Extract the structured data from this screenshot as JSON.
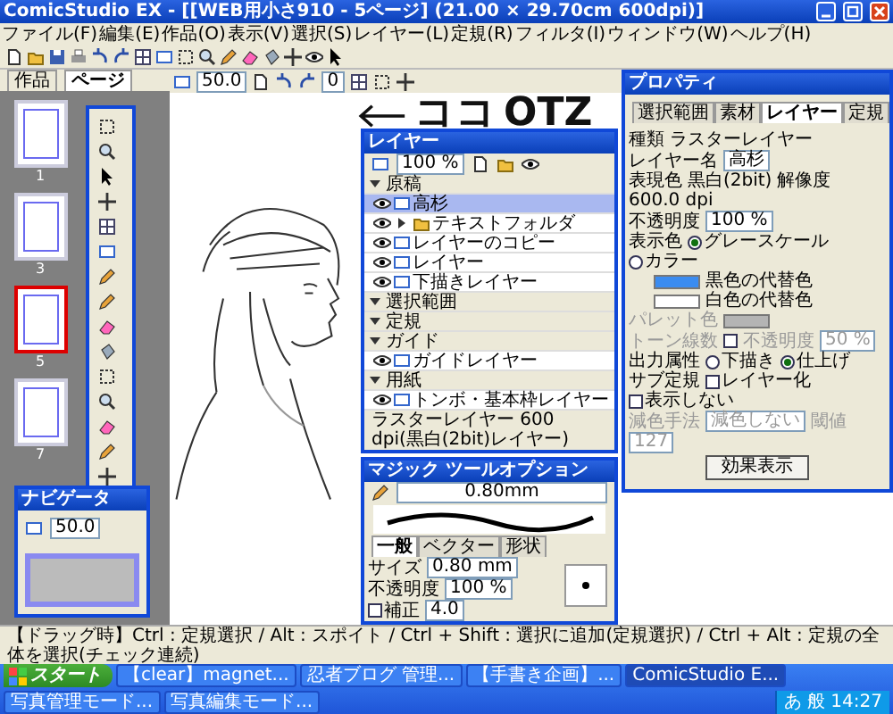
{
  "window": {
    "title": "ComicStudio EX - [[WEB用小さ910 - 5ページ] (21.00 × 29.70cm 600dpi)]"
  },
  "menu": [
    "ファイル(F)",
    "編集(E)",
    "作品(O)",
    "表示(V)",
    "選択(S)",
    "レイヤー(L)",
    "定規(R)",
    "フィルタ(I)",
    "ウィンドウ(W)",
    "ヘルプ(H)"
  ],
  "side_tabs": [
    {
      "label": "作品",
      "selected": false
    },
    {
      "label": "ページ",
      "selected": true
    }
  ],
  "pages": [
    {
      "number": "1",
      "selected": false
    },
    {
      "number": "3",
      "selected": false
    },
    {
      "number": "5",
      "selected": true
    },
    {
      "number": "7",
      "selected": false
    }
  ],
  "canvas_toolbar": {
    "zoom": "50.0",
    "rotation": "0"
  },
  "canvas": {
    "notes": [
      "ココ",
      "OTZ"
    ]
  },
  "navigator": {
    "title": "ナビゲータ",
    "zoom": "50.0"
  },
  "properties": {
    "title": "プロパティ",
    "tabs": [
      {
        "label": "選択範囲",
        "selected": false
      },
      {
        "label": "素材",
        "selected": false
      },
      {
        "label": "レイヤー",
        "selected": true
      },
      {
        "label": "定規",
        "selected": false
      }
    ],
    "rows": [
      {
        "kind": "text",
        "label": "種類",
        "value": "ラスターレイヤー"
      },
      {
        "kind": "field",
        "label": "レイヤー名",
        "value": "高杉"
      },
      {
        "kind": "pair",
        "label": "表現色",
        "value": "黒白(2bit)",
        "label2": "解像度",
        "value2": "600.0 dpi"
      },
      {
        "kind": "field",
        "label": "不透明度",
        "value": "100 %"
      },
      {
        "kind": "radio",
        "label": "表示色",
        "options": [
          {
            "label": "グレースケール",
            "selected": true
          },
          {
            "label": "カラー",
            "selected": false
          }
        ]
      },
      {
        "kind": "swatch",
        "label": "黒色の代替色",
        "color": "#3b8cf0"
      },
      {
        "kind": "swatch",
        "label": "白色の代替色",
        "color": "#ffffff"
      },
      {
        "kind": "palette",
        "label": "パレット色",
        "color": "#b4b4b4",
        "disabled": true
      },
      {
        "kind": "tone",
        "label": "トーン線数",
        "checked": false,
        "label2": "不透明度",
        "value2": "50 %",
        "disabled": true
      },
      {
        "kind": "radio",
        "label": "出力属性",
        "options": [
          {
            "label": "下描き",
            "selected": false
          },
          {
            "label": "仕上げ",
            "selected": true
          }
        ]
      },
      {
        "kind": "checks",
        "label": "サブ定規",
        "options": [
          {
            "label": "レイヤー化",
            "checked": false
          },
          {
            "label": "表示しない",
            "checked": false
          }
        ]
      },
      {
        "kind": "select",
        "label": "減色手法",
        "value": "減色しない",
        "label2": "閾値",
        "value2": "127",
        "disabled": true
      },
      {
        "kind": "button",
        "label": "効果表示"
      }
    ]
  },
  "layers": {
    "title": "レイヤー",
    "opacity": "100 %",
    "items": [
      {
        "name": "原稿",
        "kind": "group",
        "expanded": true,
        "selected": false,
        "children": [
          {
            "name": "高杉",
            "kind": "layer",
            "selected": true
          },
          {
            "name": "テキストフォルダ",
            "kind": "folder",
            "expanded": false,
            "selected": false
          },
          {
            "name": "レイヤーのコピー",
            "kind": "layer",
            "selected": false
          },
          {
            "name": "レイヤー",
            "kind": "layer",
            "selected": false
          },
          {
            "name": "下描きレイヤー",
            "kind": "layer",
            "selected": false
          }
        ]
      },
      {
        "name": "選択範囲",
        "kind": "group",
        "expanded": true,
        "selected": false
      },
      {
        "name": "定規",
        "kind": "group",
        "expanded": true,
        "selected": false
      },
      {
        "name": "ガイド",
        "kind": "group",
        "expanded": true,
        "selected": false,
        "children": [
          {
            "name": "ガイドレイヤー",
            "kind": "layer",
            "selected": false
          }
        ]
      },
      {
        "name": "用紙",
        "kind": "group",
        "expanded": true,
        "selected": false,
        "children": [
          {
            "name": "トンボ・基本枠レイヤー",
            "kind": "layer",
            "selected": false
          }
        ]
      }
    ],
    "status": "ラスターレイヤー 600 dpi(黒白(2bit)レイヤー)"
  },
  "tool_options": {
    "title": "マジック ツールオプション",
    "brush": "0.80mm",
    "tabs": [
      {
        "label": "一般",
        "selected": true
      },
      {
        "label": "ベクター",
        "selected": false
      },
      {
        "label": "形状",
        "selected": false
      }
    ],
    "rows": [
      {
        "label": "サイズ",
        "value": "0.80 mm"
      },
      {
        "label": "不透明度",
        "value": "100 %"
      },
      {
        "label": "補正",
        "value": "4.0",
        "checked": false
      }
    ]
  },
  "status_bar": "【ドラッグ時】Ctrl : 定規選択 / Alt : スポイト / Ctrl + Shift : 選択に追加(定規選択) / Ctrl + Alt : 定規の全体を選択(チェック連続)",
  "taskbar": {
    "start": "スタート",
    "buttons": [
      {
        "label": "【clear】magnet...",
        "selected": false
      },
      {
        "label": "忍者ブログ 管理...",
        "selected": false
      },
      {
        "label": "【手書き企画】...",
        "selected": false
      },
      {
        "label": "ComicStudio E...",
        "selected": true
      },
      {
        "label": "写真管理モード...",
        "selected": false
      },
      {
        "label": "写真編集モード...",
        "selected": false
      }
    ],
    "tray": [
      "あ",
      "般"
    ],
    "clock": "14:27"
  }
}
